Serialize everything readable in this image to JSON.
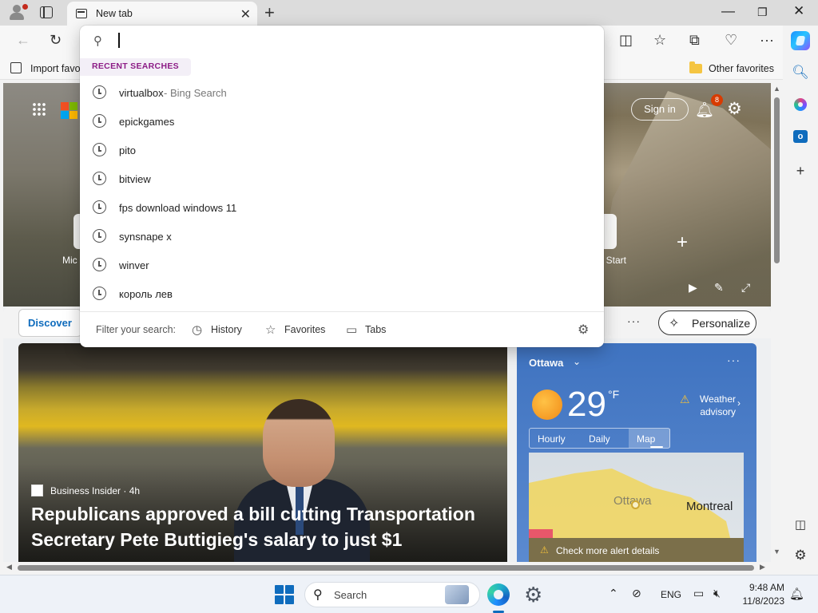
{
  "browser": {
    "tab_title": "New tab",
    "favorites_bar": {
      "import_label": "Import favo",
      "other_favorites": "Other favorites"
    }
  },
  "address_dropdown": {
    "query": "",
    "section_heading": "RECENT SEARCHES",
    "items": [
      {
        "text": "virtualbox",
        "suffix": " - Bing Search"
      },
      {
        "text": "epickgames",
        "suffix": ""
      },
      {
        "text": "pito",
        "suffix": ""
      },
      {
        "text": "bitview",
        "suffix": ""
      },
      {
        "text": "fps download windows 11",
        "suffix": ""
      },
      {
        "text": "synsnape x",
        "suffix": ""
      },
      {
        "text": "winver",
        "suffix": ""
      },
      {
        "text": "король лев",
        "suffix": ""
      }
    ],
    "filter_label": "Filter your search:",
    "filters": [
      "History",
      "Favorites",
      "Tabs"
    ]
  },
  "new_tab_page": {
    "sign_in": "Sign in",
    "notification_count": "8",
    "hero_site_left": "Mic",
    "hero_site_right": "t Start",
    "feed": {
      "discover_tab": "Discover",
      "personalize": "Personalize"
    },
    "news": {
      "source": "Business Insider · 4h",
      "headline": "Republicans approved a bill cutting Transportation Secretary Pete Buttigieg's salary to just $1"
    },
    "weather": {
      "city": "Ottawa",
      "temperature": "29",
      "unit": "°F",
      "advisory": "Weather advisory",
      "tabs": [
        "Hourly",
        "Daily",
        "Map"
      ],
      "active_tab": "Map",
      "map_labels": [
        "Ottawa",
        "Montreal"
      ],
      "alert_text": "Check more alert details"
    }
  },
  "taskbar": {
    "search_label": "Search",
    "language": "ENG",
    "time": "9:48 AM",
    "date": "11/8/2023"
  },
  "colors": {
    "accent": "#0f6cbd",
    "recent_heading": "#8c1c86",
    "notification_badge": "#d83b01"
  }
}
